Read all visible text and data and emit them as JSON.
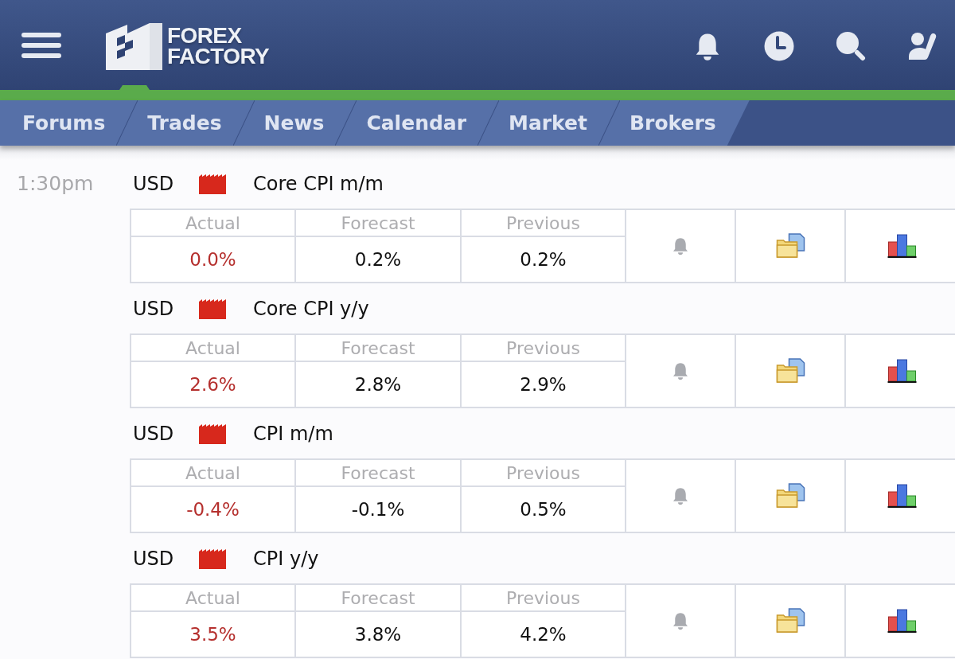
{
  "header": {
    "logo": {
      "line_1": "FOREX",
      "line_2": "FACTORY"
    }
  },
  "nav": {
    "tabs": [
      {
        "label": "Forums",
        "selected": false
      },
      {
        "label": "Trades",
        "selected": false
      },
      {
        "label": "News",
        "selected": false
      },
      {
        "label": "Calendar",
        "selected": false
      },
      {
        "label": "Market",
        "selected": false
      },
      {
        "label": "Brokers",
        "selected": false
      }
    ]
  },
  "schedule": [
    {
      "time": "1:30pm",
      "events": [
        {
          "currency": "USD",
          "impact": {
            "color": "#d7281c"
          },
          "title": "Core CPI m/m",
          "actual": {
            "label": "Actual",
            "value": "0.0%",
            "color": "#b5302e"
          },
          "forecast": {
            "label": "Forecast",
            "value": "0.2%"
          },
          "previous": {
            "label": "Previous",
            "value": "0.2%"
          }
        },
        {
          "currency": "USD",
          "impact": {
            "color": "#d7281c"
          },
          "title": "Core CPI y/y",
          "actual": {
            "label": "Actual",
            "value": "2.6%",
            "color": "#b5302e"
          },
          "forecast": {
            "label": "Forecast",
            "value": "2.8%"
          },
          "previous": {
            "label": "Previous",
            "value": "2.9%"
          }
        },
        {
          "currency": "USD",
          "impact": {
            "color": "#d7281c"
          },
          "title": "CPI m/m",
          "actual": {
            "label": "Actual",
            "value": "-0.4%",
            "color": "#b5302e"
          },
          "forecast": {
            "label": "Forecast",
            "value": "-0.1%"
          },
          "previous": {
            "label": "Previous",
            "value": "0.5%"
          }
        },
        {
          "currency": "USD",
          "impact": {
            "color": "#d7281c"
          },
          "title": "CPI y/y",
          "actual": {
            "label": "Actual",
            "value": "3.5%",
            "color": "#b5302e"
          },
          "forecast": {
            "label": "Forecast",
            "value": "3.8%"
          },
          "previous": {
            "label": "Previous",
            "value": "4.2%"
          }
        }
      ]
    }
  ]
}
